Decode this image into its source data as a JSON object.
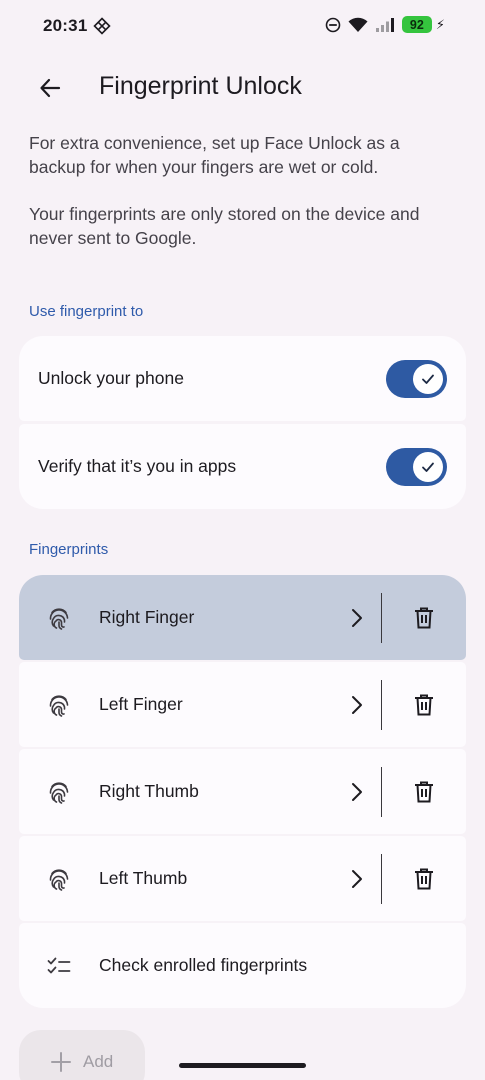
{
  "status_bar": {
    "time": "20:31",
    "app_icon": "diamond-grid-icon",
    "dnd_icon": "dnd-icon",
    "wifi_icon": "wifi-icon",
    "signal_icon": "signal-icon",
    "battery_level": "92",
    "charging_icon": "bolt-icon"
  },
  "app_bar": {
    "back_icon": "arrow-back-icon",
    "title": "Fingerprint Unlock"
  },
  "intro": {
    "paragraph_1": "For extra convenience, set up Face Unlock as a backup for when your fingers are wet or cold.",
    "paragraph_2": "Your fingerprints are only stored on the device and never sent to Google."
  },
  "use_section": {
    "header": "Use fingerprint to",
    "items": [
      {
        "label": "Unlock your phone",
        "enabled": true
      },
      {
        "label": "Verify that it’s you in apps",
        "enabled": true
      }
    ]
  },
  "fingerprints_section": {
    "header": "Fingerprints",
    "items": [
      {
        "label": "Right Finger",
        "highlighted": true
      },
      {
        "label": "Left Finger",
        "highlighted": false
      },
      {
        "label": "Right Thumb",
        "highlighted": false
      },
      {
        "label": "Left Thumb",
        "highlighted": false
      }
    ],
    "check_enrolled_label": "Check enrolled fingerprints"
  },
  "add_button": {
    "label": "Add",
    "icon": "plus-icon"
  },
  "colors": {
    "accent": "#2e5aa3",
    "section_header": "#2f5bab",
    "highlight_row": "#c4ccdc",
    "background": "#f7f2f7",
    "card": "#fdfbfe",
    "battery": "#35c43e"
  }
}
